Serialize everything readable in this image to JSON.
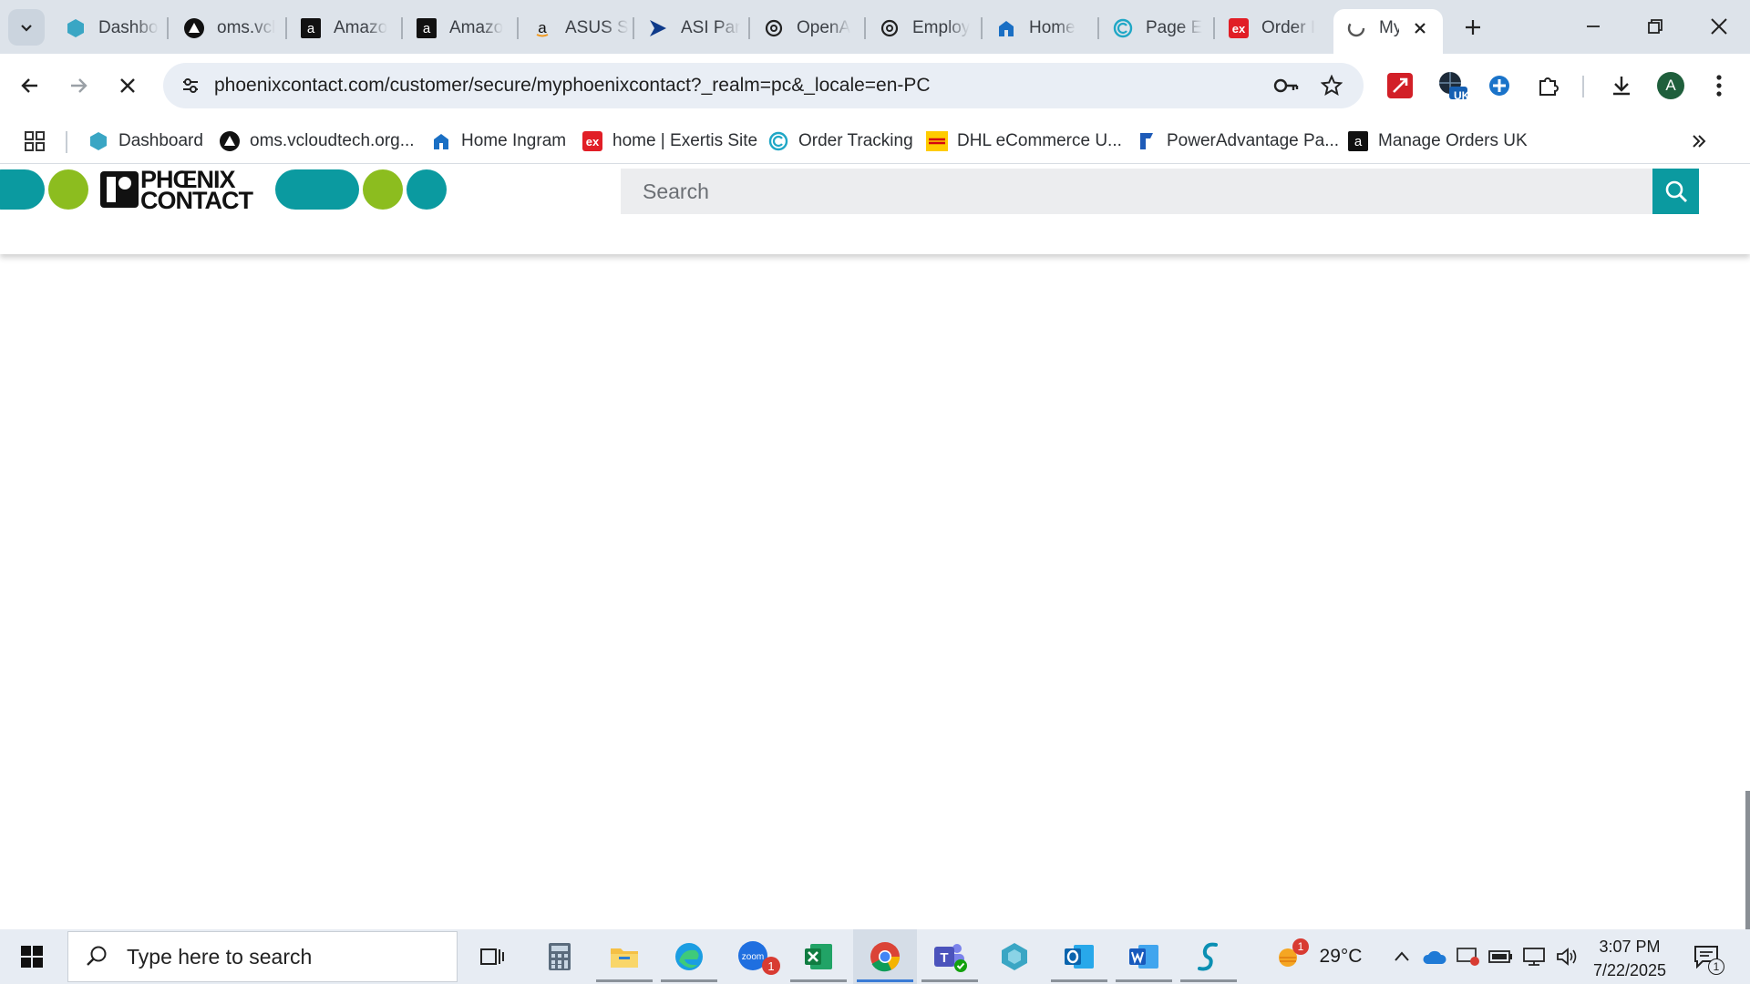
{
  "browser": {
    "tabs": [
      {
        "title": "Dashbo",
        "icon": "dashboard-hex-icon"
      },
      {
        "title": "oms.vcl",
        "icon": "oms-triangle-icon"
      },
      {
        "title": "Amazo",
        "icon": "amazon-icon"
      },
      {
        "title": "Amazo",
        "icon": "amazon-icon"
      },
      {
        "title": "ASUS S",
        "icon": "amazon-icon"
      },
      {
        "title": "ASI Par",
        "icon": "asi-arrow-icon"
      },
      {
        "title": "OpenA",
        "icon": "openai-icon"
      },
      {
        "title": "Employ",
        "icon": "openai-icon"
      },
      {
        "title": "Home",
        "icon": "ingram-icon"
      },
      {
        "title": "Page E",
        "icon": "circle-c-icon"
      },
      {
        "title": "Order I",
        "icon": "exertis-icon"
      },
      {
        "title": "My",
        "icon": "phoenix-icon"
      }
    ],
    "active_tab_index": 11,
    "url": "phoenixcontact.com/customer/secure/myphoenixcontact?_realm=pc&_locale=en-PC",
    "profile_initial": "A",
    "extension_badge": "UK",
    "bookmarks": [
      {
        "label": "Dashboard",
        "icon": "dashboard-hex-icon"
      },
      {
        "label": "oms.vcloudtech.org...",
        "icon": "oms-triangle-icon"
      },
      {
        "label": "Home Ingram",
        "icon": "ingram-icon"
      },
      {
        "label": "home | Exertis Site",
        "icon": "exertis-icon"
      },
      {
        "label": "Order Tracking",
        "icon": "circle-c-icon"
      },
      {
        "label": "DHL eCommerce U...",
        "icon": "dhl-icon"
      },
      {
        "label": "PowerAdvantage Pa...",
        "icon": "poweradvantage-icon"
      },
      {
        "label": "Manage Orders UK",
        "icon": "amazon-icon"
      }
    ]
  },
  "site": {
    "logo_line1": "PHŒNIX",
    "logo_line2": "CONTACT",
    "search_placeholder": "Search",
    "colors": {
      "teal": "#0b9aa0",
      "lime": "#8cbd1f"
    }
  },
  "taskbar": {
    "search_placeholder": "Type here to search",
    "weather_temp": "29°C",
    "weather_badge": "1",
    "zoom_badge": "1",
    "time": "3:07 PM",
    "date": "7/22/2025",
    "notification_count": "1"
  }
}
